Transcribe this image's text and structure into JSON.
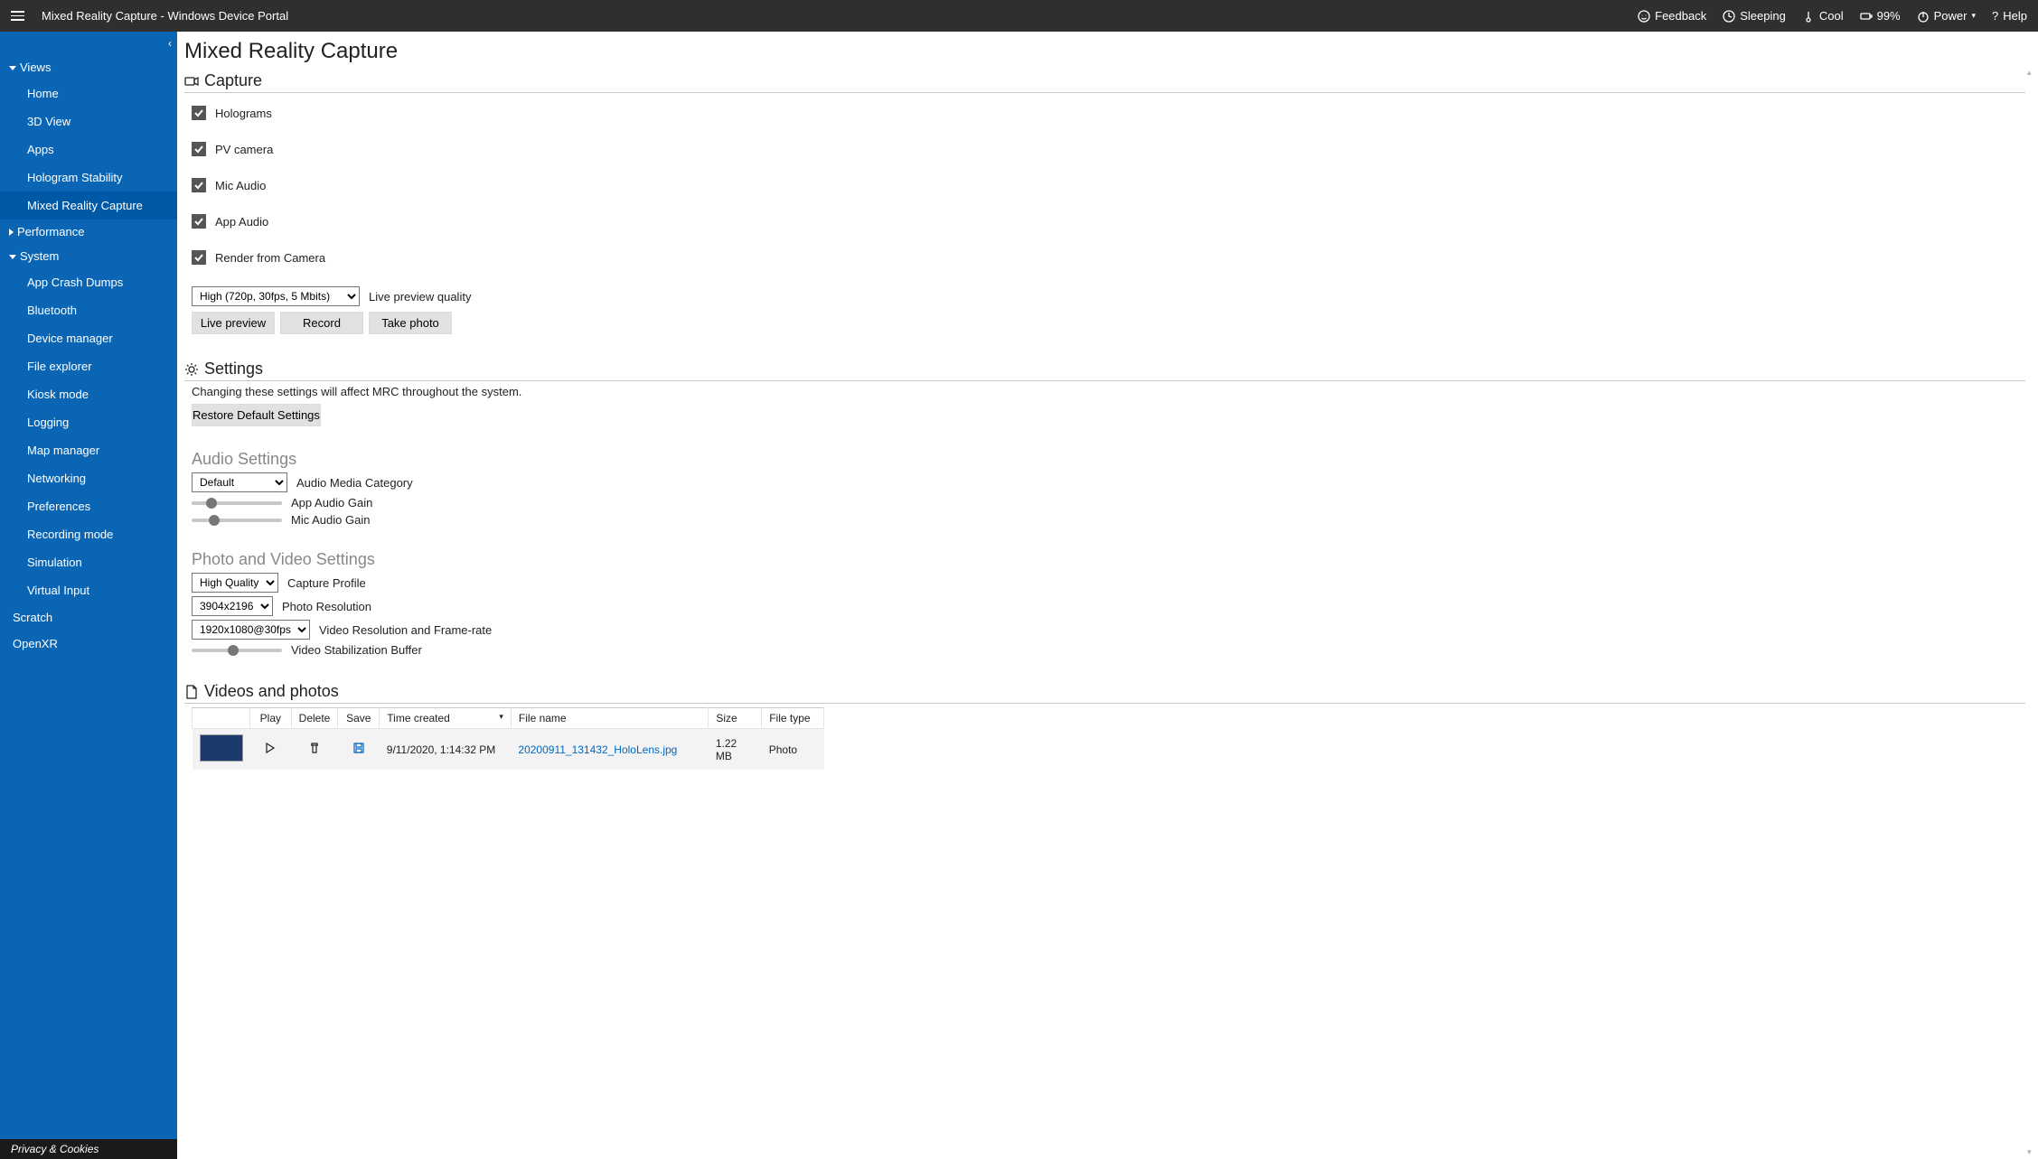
{
  "topbar": {
    "title": "Mixed Reality Capture - Windows Device Portal",
    "feedback": "Feedback",
    "sleeping": "Sleeping",
    "cool": "Cool",
    "battery": "99%",
    "power": "Power",
    "help": "Help"
  },
  "sidebar": {
    "views": {
      "label": "Views",
      "items": [
        "Home",
        "3D View",
        "Apps",
        "Hologram Stability",
        "Mixed Reality Capture"
      ]
    },
    "performance": {
      "label": "Performance"
    },
    "system": {
      "label": "System",
      "items": [
        "App Crash Dumps",
        "Bluetooth",
        "Device manager",
        "File explorer",
        "Kiosk mode",
        "Logging",
        "Map manager",
        "Networking",
        "Preferences",
        "Recording mode",
        "Simulation",
        "Virtual Input"
      ]
    },
    "scratch": "Scratch",
    "openxr": "OpenXR",
    "footer": "Privacy & Cookies"
  },
  "page": {
    "title": "Mixed Reality Capture",
    "capture": {
      "header": "Capture",
      "holograms": "Holograms",
      "pv_camera": "PV camera",
      "mic_audio": "Mic Audio",
      "app_audio": "App Audio",
      "render_from_camera": "Render from Camera",
      "quality_options": [
        "High (720p, 30fps, 5 Mbits)"
      ],
      "quality_selected": "High (720p, 30fps, 5 Mbits)",
      "quality_label": "Live preview quality",
      "live_preview_btn": "Live preview",
      "record_btn": "Record",
      "take_photo_btn": "Take photo"
    },
    "settings": {
      "header": "Settings",
      "note": "Changing these settings will affect MRC throughout the system.",
      "restore_btn": "Restore Default Settings",
      "audio_header": "Audio Settings",
      "audio_category_selected": "Default",
      "audio_category_label": "Audio Media Category",
      "app_audio_gain": "App Audio Gain",
      "mic_audio_gain": "Mic Audio Gain",
      "pv_header": "Photo and Video Settings",
      "capture_profile_selected": "High Quality",
      "capture_profile_label": "Capture Profile",
      "photo_res_selected": "3904x2196",
      "photo_res_label": "Photo Resolution",
      "video_res_selected": "1920x1080@30fps",
      "video_res_label": "Video Resolution and Frame-rate",
      "video_stab": "Video Stabilization Buffer"
    },
    "files": {
      "header": "Videos and photos",
      "cols": {
        "play": "Play",
        "delete": "Delete",
        "save": "Save",
        "time": "Time created",
        "name": "File name",
        "size": "Size",
        "type": "File type"
      },
      "rows": [
        {
          "time": "9/11/2020, 1:14:32 PM",
          "name": "20200911_131432_HoloLens.jpg",
          "size": "1.22 MB",
          "type": "Photo"
        }
      ]
    }
  }
}
